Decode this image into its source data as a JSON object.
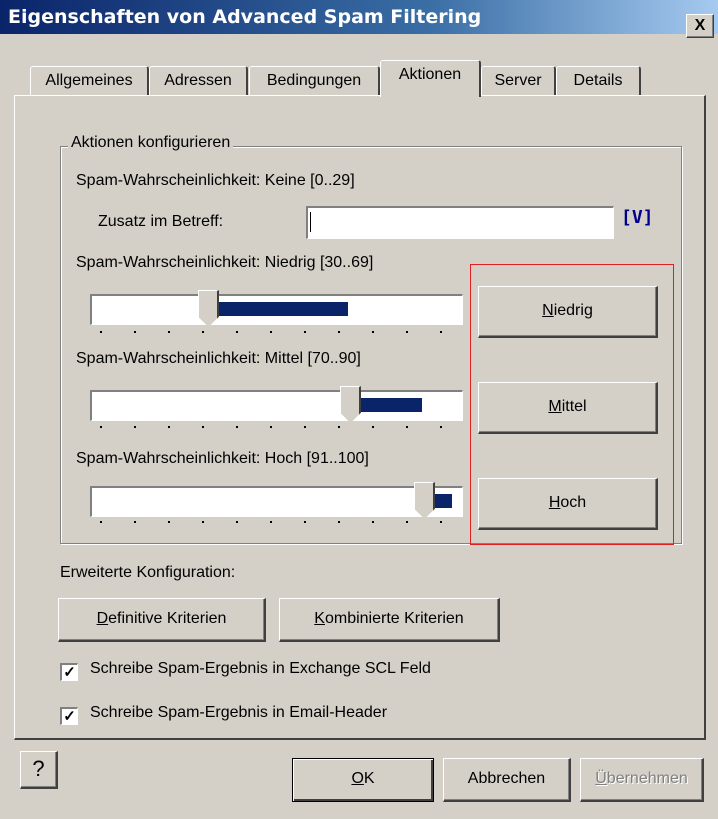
{
  "window": {
    "title": "Eigenschaften von Advanced Spam Filtering",
    "close_label": "X"
  },
  "tabs": [
    {
      "label": "Allgemeines",
      "active": false
    },
    {
      "label": "Adressen",
      "active": false
    },
    {
      "label": "Bedingungen",
      "active": false
    },
    {
      "label": "Aktionen",
      "active": true
    },
    {
      "label": "Server",
      "active": false
    },
    {
      "label": "Details",
      "active": false
    }
  ],
  "group": {
    "title": "Aktionen konfigurieren",
    "none_label": "Spam-Wahrscheinlichkeit: Keine [0..29]",
    "subject_label": "Zusatz im Betreff:",
    "subject_value": "",
    "var_button": "[V]",
    "low_label": "Spam-Wahrscheinlichkeit: Niedrig [30..69]",
    "medium_label": "Spam-Wahrscheinlichkeit: Mittel [70..90]",
    "high_label": "Spam-Wahrscheinlichkeit: Hoch [91..100]",
    "sliders": {
      "low": {
        "range_min": 30,
        "range_max": 69
      },
      "medium": {
        "range_min": 70,
        "range_max": 90
      },
      "high": {
        "range_min": 91,
        "range_max": 100
      }
    },
    "buttons": {
      "low_key": "N",
      "low_rest": "iedrig",
      "medium_key": "M",
      "medium_rest": "ittel",
      "high_key": "H",
      "high_rest": "och"
    }
  },
  "extended": {
    "label": "Erweiterte Konfiguration:",
    "definitive_key": "D",
    "definitive_rest": "efinitive Kriterien",
    "combined_key": "K",
    "combined_rest": "ombinierte Kriterien"
  },
  "checkboxes": [
    {
      "label": "Schreibe Spam-Ergebnis in Exchange SCL Feld",
      "checked": true
    },
    {
      "label": "Schreibe Spam-Ergebnis in Email-Header",
      "checked": true
    }
  ],
  "footer": {
    "help_icon": "help-icon",
    "ok_key": "O",
    "ok_rest": "K",
    "cancel_label": "Abbrechen",
    "apply_key": "Ü",
    "apply_rest": "bernehmen",
    "apply_enabled": false
  },
  "colors": {
    "face": "#d4d0c8",
    "title_start": "#0a246a",
    "slider_fill": "#0a246a",
    "highlight": "#e02020"
  }
}
